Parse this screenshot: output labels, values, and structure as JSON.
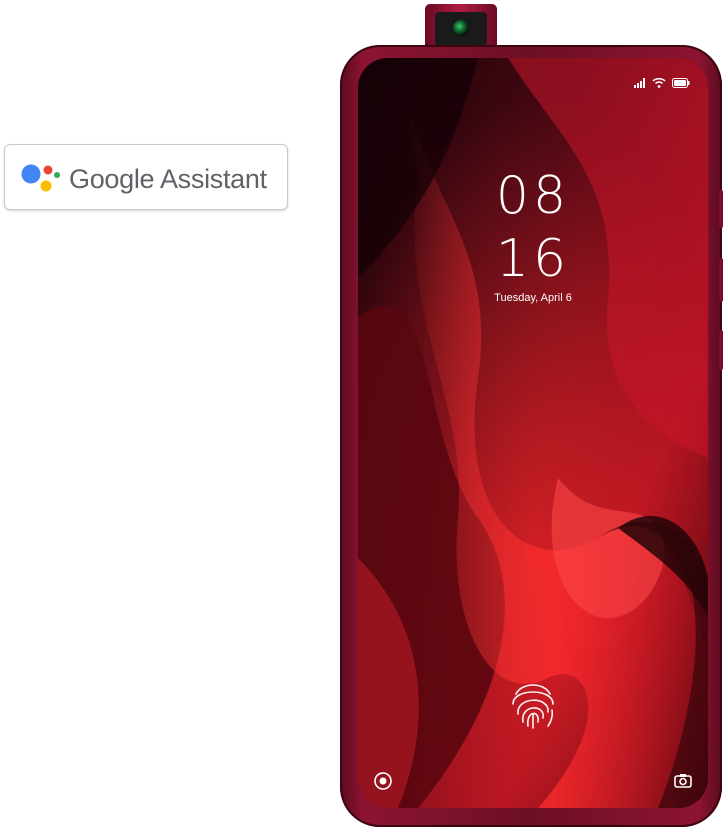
{
  "badge": {
    "text": "Google Assistant",
    "icon": "google-assistant-icon",
    "dot_colors": [
      "#4285F4",
      "#EA4335",
      "#FBBC05",
      "#34A853"
    ]
  },
  "phone": {
    "body_color": "#8c1432",
    "lockscreen": {
      "hours": "08",
      "minutes": "16",
      "date": "Tuesday, April 6"
    },
    "status_icons": [
      "signal-icon",
      "wifi-icon",
      "battery-icon"
    ],
    "bottom_icons": {
      "left": "camera-shortcut-icon",
      "right": "camera-icon"
    },
    "fingerprint_icon": "fingerprint-icon"
  }
}
